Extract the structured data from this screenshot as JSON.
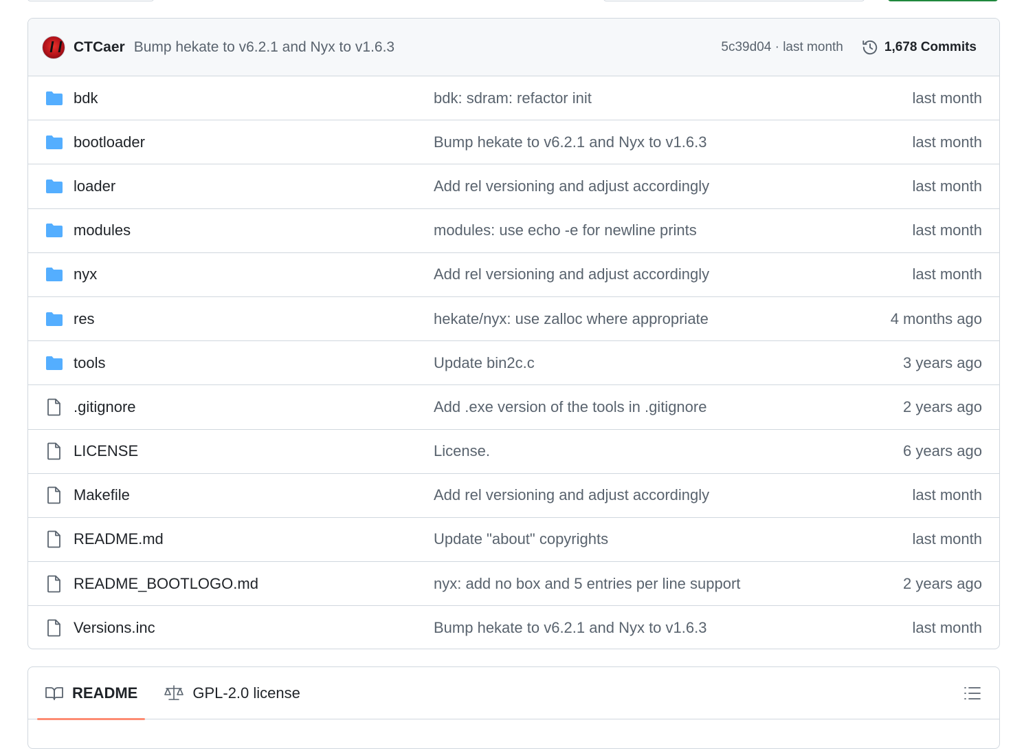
{
  "commit_bar": {
    "author": "CTCaer",
    "message": "Bump hekate to v6.2.1 and Nyx to v1.6.3",
    "sha_time": "5c39d04 · last month",
    "commits_label": "1,678 Commits"
  },
  "files": [
    {
      "type": "folder",
      "name": "bdk",
      "message": "bdk: sdram: refactor init",
      "age": "last month"
    },
    {
      "type": "folder",
      "name": "bootloader",
      "message": "Bump hekate to v6.2.1 and Nyx to v1.6.3",
      "age": "last month"
    },
    {
      "type": "folder",
      "name": "loader",
      "message": "Add rel versioning and adjust accordingly",
      "age": "last month"
    },
    {
      "type": "folder",
      "name": "modules",
      "message": "modules: use echo -e for newline prints",
      "age": "last month"
    },
    {
      "type": "folder",
      "name": "nyx",
      "message": "Add rel versioning and adjust accordingly",
      "age": "last month"
    },
    {
      "type": "folder",
      "name": "res",
      "message": "hekate/nyx: use zalloc where appropriate",
      "age": "4 months ago"
    },
    {
      "type": "folder",
      "name": "tools",
      "message": "Update bin2c.c",
      "age": "3 years ago"
    },
    {
      "type": "file",
      "name": ".gitignore",
      "message": "Add .exe version of the tools in .gitignore",
      "age": "2 years ago"
    },
    {
      "type": "file",
      "name": "LICENSE",
      "message": "License.",
      "age": "6 years ago"
    },
    {
      "type": "file",
      "name": "Makefile",
      "message": "Add rel versioning and adjust accordingly",
      "age": "last month"
    },
    {
      "type": "file",
      "name": "README.md",
      "message": "Update \"about\" copyrights",
      "age": "last month"
    },
    {
      "type": "file",
      "name": "README_BOOTLOGO.md",
      "message": "nyx: add no box and 5 entries per line support",
      "age": "2 years ago"
    },
    {
      "type": "file",
      "name": "Versions.inc",
      "message": "Bump hekate to v6.2.1 and Nyx to v1.6.3",
      "age": "last month"
    }
  ],
  "readme_tabs": [
    {
      "label": "README",
      "icon": "book-icon",
      "active": true
    },
    {
      "label": "GPL-2.0 license",
      "icon": "law-icon",
      "active": false
    }
  ],
  "colors": {
    "folder": "#54aeff",
    "file_icon": "#59636e",
    "active_tab_underline": "#fd8c73",
    "muted_text": "#59636e",
    "border": "#d0d7de"
  }
}
